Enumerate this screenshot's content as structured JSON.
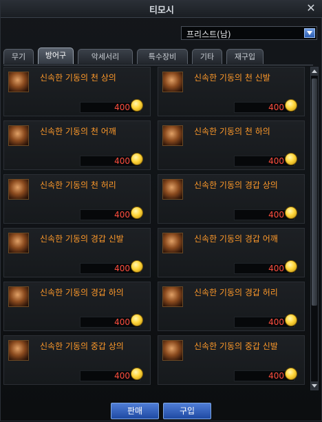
{
  "window": {
    "title": "티모시",
    "close_symbol": "✕"
  },
  "filter": {
    "selected": "프리스트(남)"
  },
  "tabs": [
    {
      "label": "무기",
      "active": false
    },
    {
      "label": "방어구",
      "active": true
    },
    {
      "label": "악세서리",
      "active": false
    },
    {
      "label": "특수장비",
      "active": false
    },
    {
      "label": "기타",
      "active": false
    },
    {
      "label": "재구입",
      "active": false
    }
  ],
  "items": [
    {
      "name": "신속한 기동의 천 상의",
      "price": "400",
      "icon": "cloth-top-armor-icon"
    },
    {
      "name": "신속한 기동의 천 신발",
      "price": "400",
      "icon": "cloth-shoes-armor-icon"
    },
    {
      "name": "신속한 기동의 천 어깨",
      "price": "400",
      "icon": "cloth-shoulder-armor-icon"
    },
    {
      "name": "신속한 기동의 천 하의",
      "price": "400",
      "icon": "cloth-pants-armor-icon"
    },
    {
      "name": "신속한 기동의 천 허리",
      "price": "400",
      "icon": "cloth-belt-armor-icon"
    },
    {
      "name": "신속한 기동의 경갑 상의",
      "price": "400",
      "icon": "light-top-armor-icon"
    },
    {
      "name": "신속한 기동의 경갑 신발",
      "price": "400",
      "icon": "light-shoes-armor-icon"
    },
    {
      "name": "신속한 기동의 경갑 어깨",
      "price": "400",
      "icon": "light-shoulder-armor-icon"
    },
    {
      "name": "신속한 기동의 경갑 하의",
      "price": "400",
      "icon": "light-pants-armor-icon"
    },
    {
      "name": "신속한 기동의 경갑 허리",
      "price": "400",
      "icon": "light-belt-armor-icon"
    },
    {
      "name": "신속한 기동의 중갑 상의",
      "price": "400",
      "icon": "heavy-top-armor-icon"
    },
    {
      "name": "신속한 기동의 중갑 신발",
      "price": "400",
      "icon": "heavy-shoes-armor-icon"
    }
  ],
  "currency_icon": "gold-coin-icon",
  "buttons": {
    "sell": "판매",
    "buy": "구입"
  },
  "colors": {
    "item_name": "#ff9a2a",
    "price": "#ff4d3d",
    "button": "#2f5fc0"
  }
}
